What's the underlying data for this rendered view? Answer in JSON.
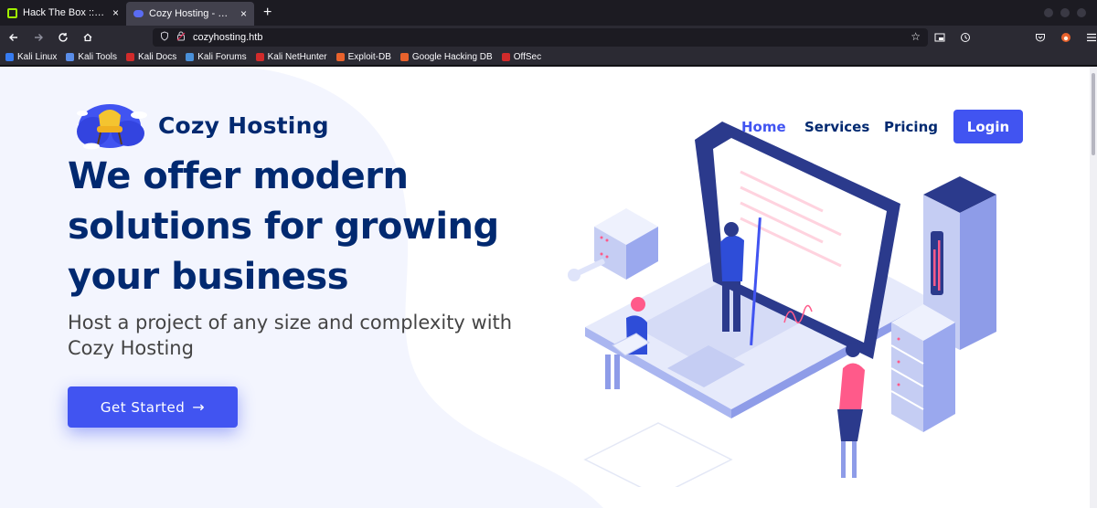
{
  "browser": {
    "tabs": [
      {
        "title": "Hack The Box :: Hack The",
        "active": false
      },
      {
        "title": "Cozy Hosting - Home",
        "active": true
      }
    ],
    "new_tab_symbol": "+",
    "close_symbol": "×",
    "url": "cozyhosting.htb",
    "bookmarks": [
      {
        "label": "Kali Linux",
        "color": "#367bf0"
      },
      {
        "label": "Kali Tools",
        "color": "#5a8de8"
      },
      {
        "label": "Kali Docs",
        "color": "#d12b2b"
      },
      {
        "label": "Kali Forums",
        "color": "#4a90d9"
      },
      {
        "label": "Kali NetHunter",
        "color": "#d12b2b"
      },
      {
        "label": "Exploit-DB",
        "color": "#e8622c"
      },
      {
        "label": "Google Hacking DB",
        "color": "#e8622c"
      },
      {
        "label": "OffSec",
        "color": "#d12b2b"
      }
    ]
  },
  "site": {
    "brand": "Cozy Hosting",
    "nav": {
      "home": "Home",
      "services": "Services",
      "pricing": "Pricing",
      "login": "Login"
    },
    "hero": {
      "title": "We offer modern solutions for growing your business",
      "subtitle": "Host a project of any size and complexity with Cozy Hosting",
      "cta": "Get Started",
      "cta_arrow": "→"
    }
  },
  "colors": {
    "primary": "#4154f1",
    "heading": "#012970",
    "text": "#444444"
  }
}
